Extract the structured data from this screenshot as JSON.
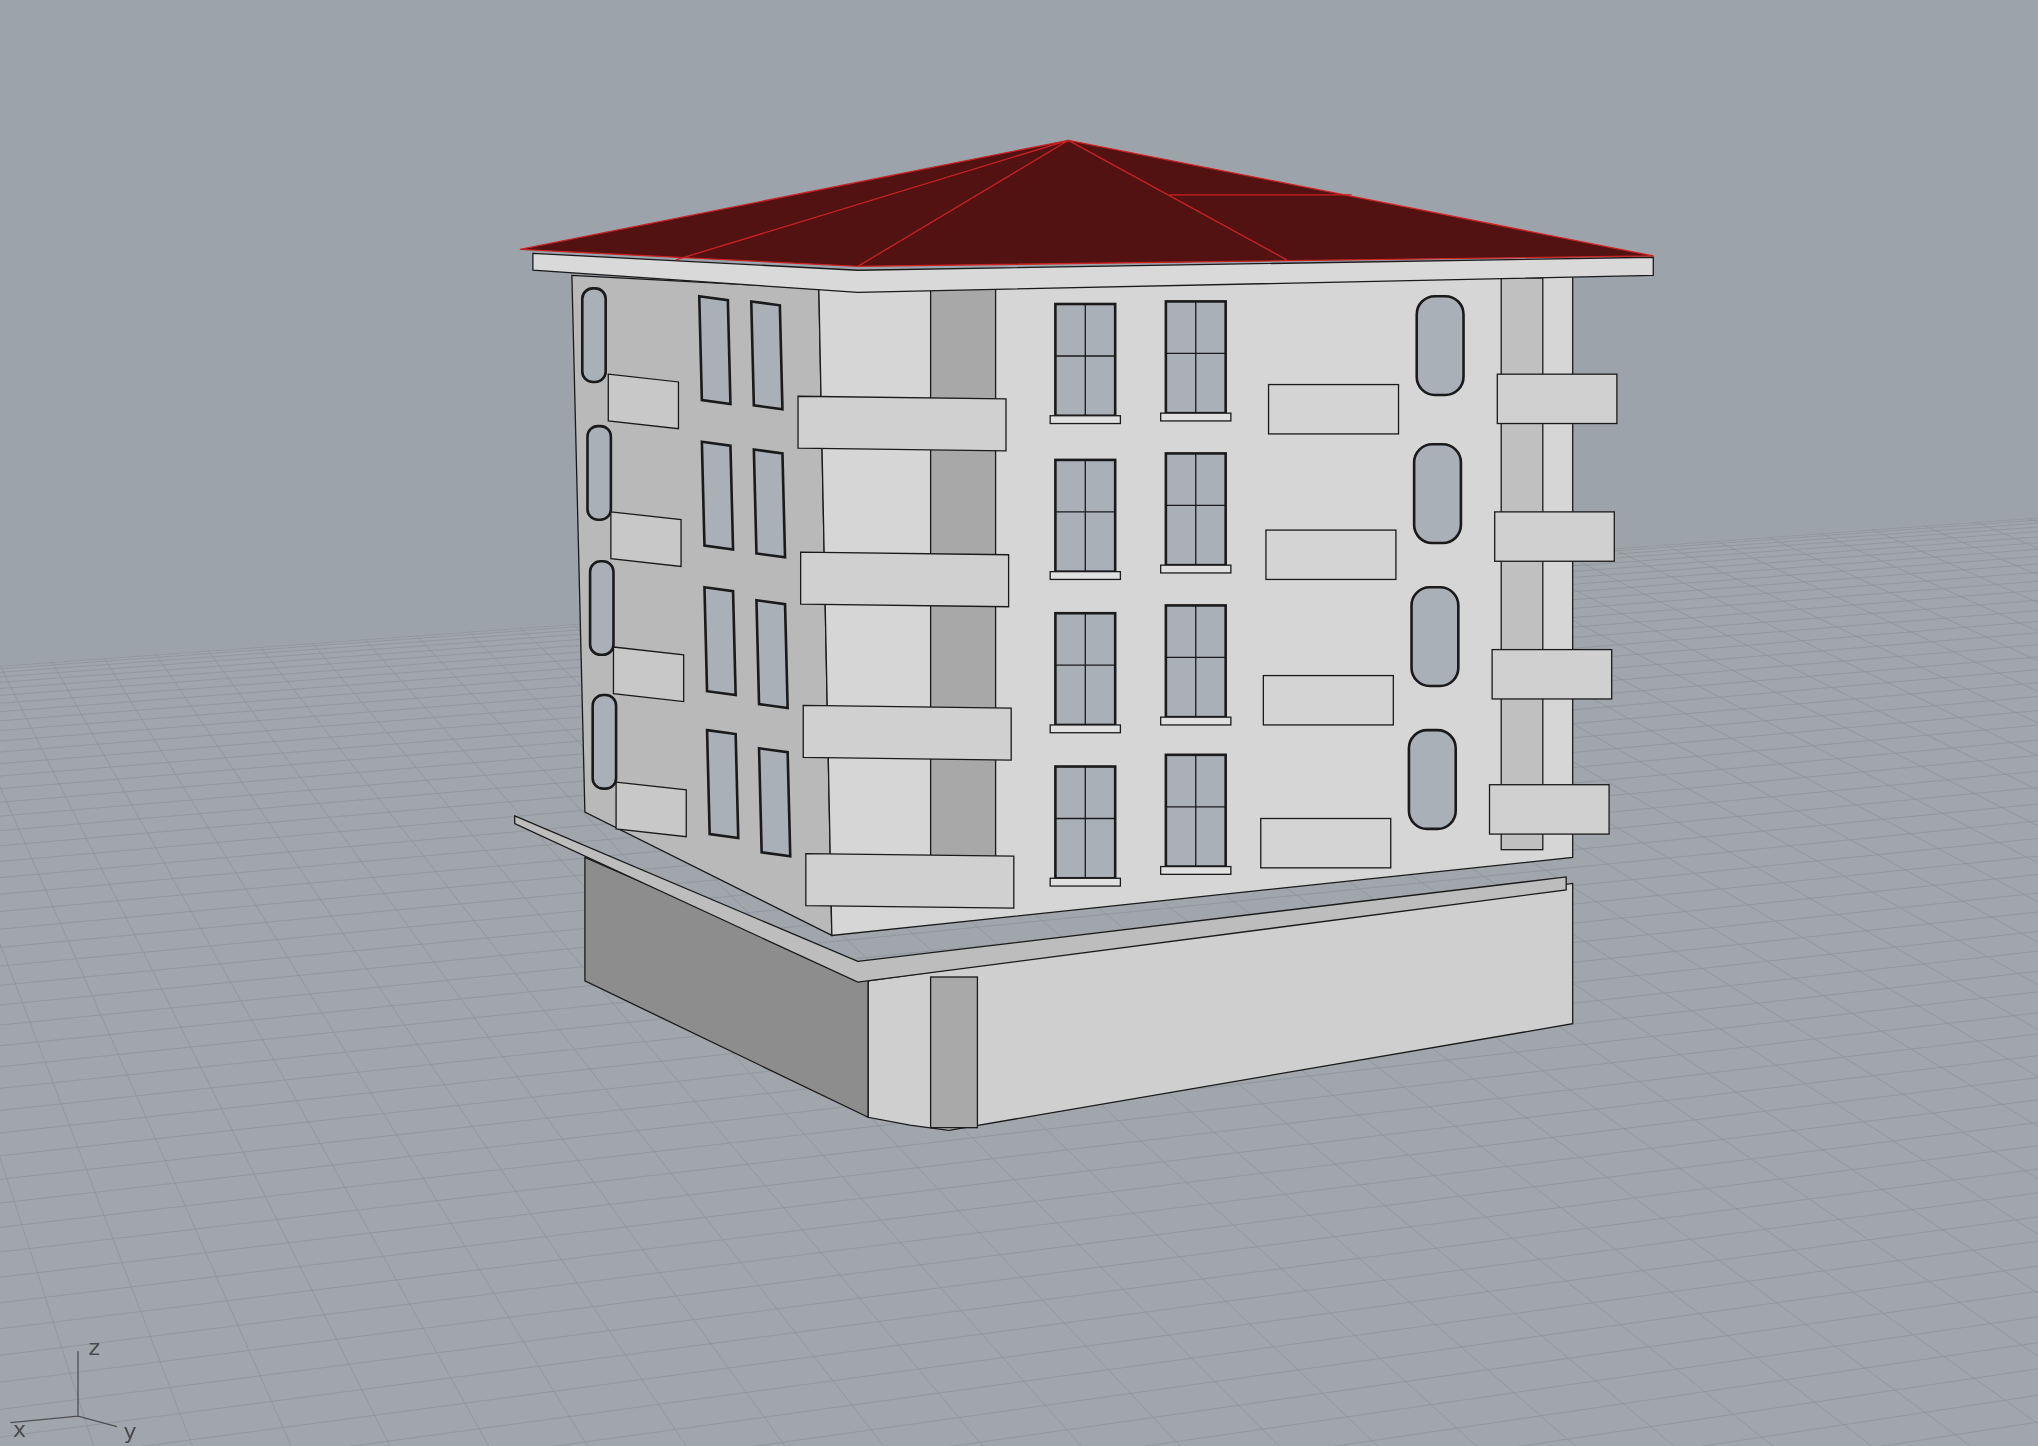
{
  "viewport": {
    "axis_labels": [
      "z",
      "x",
      "y"
    ]
  }
}
